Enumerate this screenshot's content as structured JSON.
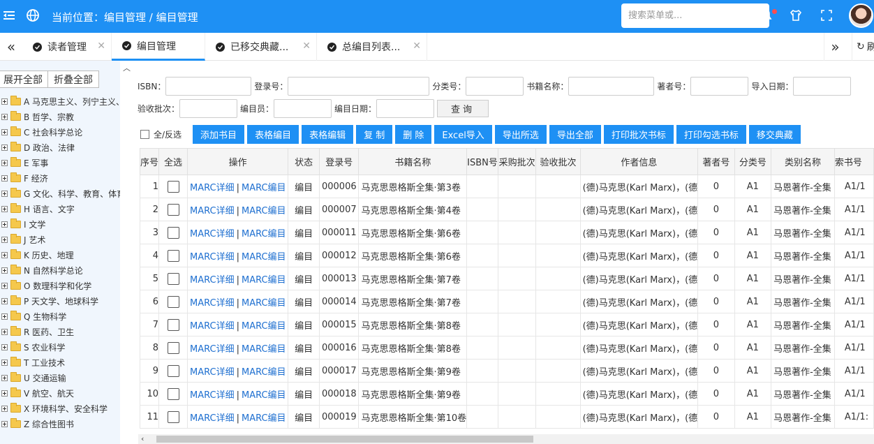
{
  "header": {
    "breadcrumb": "当前位置：编目管理 / 编目管理",
    "search_placeholder": "搜索菜单或...",
    "icons": [
      "menu-icon",
      "globe-icon",
      "bell-icon",
      "shirt-icon",
      "fullscreen-icon"
    ],
    "accent_color": "#1e90f4"
  },
  "tabs": [
    {
      "label": "读者管理",
      "active": false
    },
    {
      "label": "编目管理",
      "active": true
    },
    {
      "label": "已移交典藏...",
      "active": false
    },
    {
      "label": "总编目列表...",
      "active": false
    }
  ],
  "tabbar": {
    "refresh_label": "刷新"
  },
  "sidebar": {
    "expand_all": "展开全部",
    "collapse_all": "折叠全部",
    "items": [
      "A 马克思主义、列宁主义、",
      "B 哲学、宗教",
      "C 社会科学总论",
      "D 政治、法律",
      "E 军事",
      "F 经济",
      "G 文化、科学、教育、体育",
      "H 语言、文字",
      "I 文学",
      "J 艺术",
      "K 历史、地理",
      "N 自然科学总论",
      "O 数理科学和化学",
      "P 天文学、地球科学",
      "Q 生物科学",
      "R 医药、卫生",
      "S 农业科学",
      "T 工业技术",
      "U 交通运输",
      "V 航空、航天",
      "X 环境科学、安全科学",
      "Z 综合性图书"
    ]
  },
  "filters": {
    "isbn": "ISBN：",
    "login_no": "登录号：",
    "class_no": "分类号：",
    "book_name": "书籍名称：",
    "author_no": "著者号：",
    "import_date": "导入日期：",
    "batch": "验收批次：",
    "cataloger": "编目员：",
    "catalog_date": "编目日期：",
    "query": "查询"
  },
  "toolbar": {
    "select_all": "全/反选",
    "buttons": [
      "添加书目",
      "表格编目",
      "表格编辑",
      "复 制",
      "删 除",
      "Excel导入",
      "导出所选",
      "导出全部",
      "打印批次书标",
      "打印勾选书标",
      "移交典藏"
    ]
  },
  "table": {
    "columns": [
      "序号",
      "全选",
      "操作",
      "状态",
      "登录号",
      "书籍名称",
      "ISBN号",
      "采购批次",
      "验收批次",
      "作者信息",
      "著者号",
      "分类号",
      "类别名称",
      "索书号"
    ],
    "link_detail": "MARC详细",
    "link_sep": "|",
    "link_edit": "MARC编目",
    "rows": [
      {
        "seq": "1",
        "status": "编目",
        "login": "000006",
        "title": "马克思恩格斯全集·第3卷",
        "author": "(德)马克思(Karl Marx)，(德",
        "author_no": "0",
        "class": "A1",
        "category": "马恩著作-全集",
        "call_no": "A1/1"
      },
      {
        "seq": "2",
        "status": "编目",
        "login": "000007",
        "title": "马克思恩格斯全集·第4卷",
        "author": "(德)马克思(Karl Marx)，(德",
        "author_no": "0",
        "class": "A1",
        "category": "马恩著作-全集",
        "call_no": "A1/1"
      },
      {
        "seq": "3",
        "status": "编目",
        "login": "000011",
        "title": "马克思恩格斯全集·第6卷",
        "author": "(德)马克思(Karl Marx)，(德",
        "author_no": "0",
        "class": "A1",
        "category": "马恩著作-全集",
        "call_no": "A1/1"
      },
      {
        "seq": "4",
        "status": "编目",
        "login": "000012",
        "title": "马克思恩格斯全集·第6卷",
        "author": "(德)马克思(Karl Marx)，(德",
        "author_no": "0",
        "class": "A1",
        "category": "马恩著作-全集",
        "call_no": "A1/1"
      },
      {
        "seq": "5",
        "status": "编目",
        "login": "000013",
        "title": "马克思恩格斯全集·第7卷",
        "author": "(德)马克思(Karl Marx)，(德",
        "author_no": "0",
        "class": "A1",
        "category": "马恩著作-全集",
        "call_no": "A1/1"
      },
      {
        "seq": "6",
        "status": "编目",
        "login": "000014",
        "title": "马克思恩格斯全集·第7卷",
        "author": "(德)马克思(Karl Marx)，(德",
        "author_no": "0",
        "class": "A1",
        "category": "马恩著作-全集",
        "call_no": "A1/1"
      },
      {
        "seq": "7",
        "status": "编目",
        "login": "000015",
        "title": "马克思恩格斯全集·第8卷",
        "author": "(德)马克思(Karl Marx)，(德",
        "author_no": "0",
        "class": "A1",
        "category": "马恩著作-全集",
        "call_no": "A1/1"
      },
      {
        "seq": "8",
        "status": "编目",
        "login": "000016",
        "title": "马克思恩格斯全集·第8卷",
        "author": "(德)马克思(Karl Marx)，(德",
        "author_no": "0",
        "class": "A1",
        "category": "马恩著作-全集",
        "call_no": "A1/1"
      },
      {
        "seq": "9",
        "status": "编目",
        "login": "000017",
        "title": "马克思恩格斯全集·第9卷",
        "author": "(德)马克思(Karl Marx)，(德",
        "author_no": "0",
        "class": "A1",
        "category": "马恩著作-全集",
        "call_no": "A1/1"
      },
      {
        "seq": "10",
        "status": "编目",
        "login": "000018",
        "title": "马克思恩格斯全集·第9卷",
        "author": "(德)马克思(Karl Marx)，(德",
        "author_no": "0",
        "class": "A1",
        "category": "马恩著作-全集",
        "call_no": "A1/1"
      },
      {
        "seq": "11",
        "status": "编目",
        "login": "000019",
        "title": "马克思恩格斯全集·第10卷",
        "author": "(德)马克思(Karl Marx)，(德",
        "author_no": "0",
        "class": "A1",
        "category": "马恩著作-全集",
        "call_no": "A1/1:"
      }
    ]
  }
}
